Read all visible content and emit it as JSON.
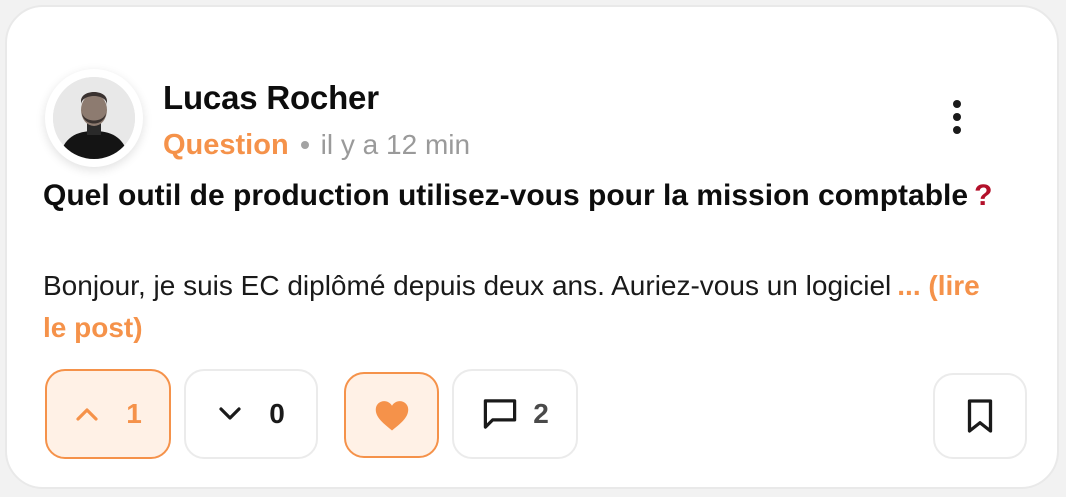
{
  "post": {
    "author_name": "Lucas Rocher",
    "category": "Question",
    "time_ago": "il y a 12 min",
    "title": "Quel outil de production utilisez-vous pour la mission comptable",
    "title_suffix": "?",
    "body_excerpt": "Bonjour, je suis EC diplômé depuis deux ans. Auriez-vous un logiciel",
    "read_more_label": "... (lire le post)"
  },
  "actions": {
    "upvote_count": "1",
    "downvote_count": "0",
    "comment_count": "2"
  },
  "icons": {
    "avatar": "author-avatar-photo",
    "more": "more-vertical-icon",
    "upvote": "chevron-up-icon",
    "downvote": "chevron-down-icon",
    "like": "heart-icon",
    "comment": "comment-icon",
    "bookmark": "bookmark-icon"
  },
  "colors": {
    "accent": "#f5924a",
    "accent_bg": "#fff1e6",
    "question_mark": "#b3102a",
    "text": "#0d0d0d",
    "muted": "#9a9a9a",
    "border": "#ebebeb"
  }
}
